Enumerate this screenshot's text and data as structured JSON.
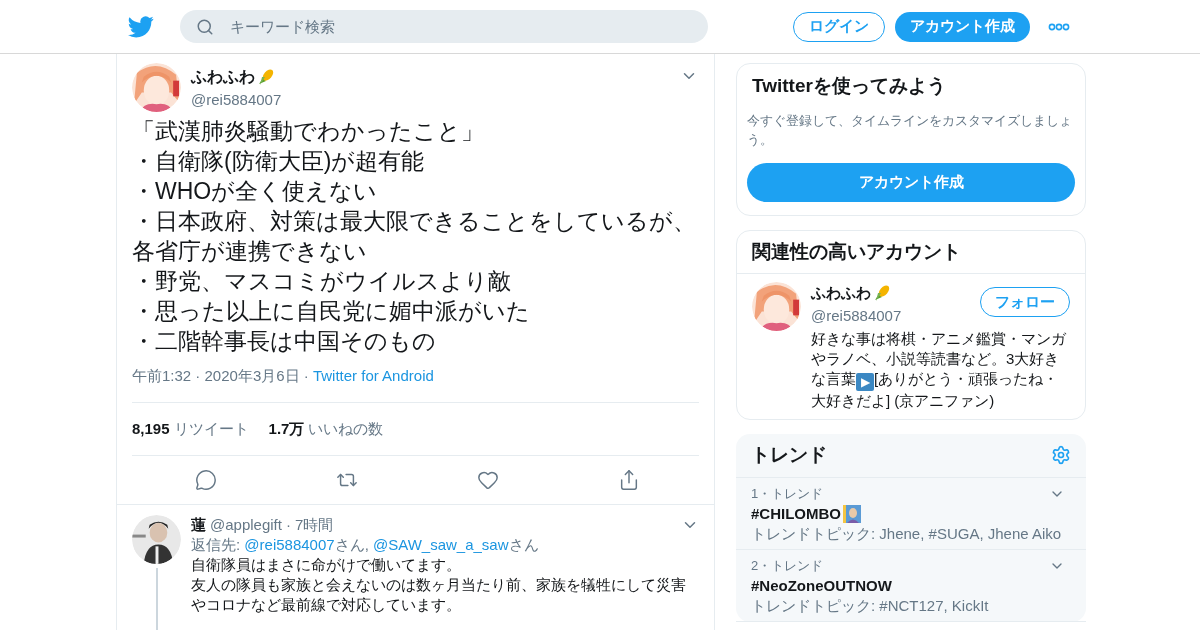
{
  "header": {
    "search_placeholder": "キーワード検索",
    "login": "ログイン",
    "signup": "アカウント作成"
  },
  "tweet": {
    "name": "ふわふわ",
    "handle": "@rei5884007",
    "lines": [
      "「武漢肺炎騒動でわかったこと」",
      "・自衛隊(防衛大臣)が超有能",
      "・WHOが全く使えない",
      "・日本政府、対策は最大限できることをしているが、各省庁が連携できない",
      "・野党、マスコミがウイルスより敵",
      "・思った以上に自民党に媚中派がいた",
      "・二階幹事長は中国そのもの"
    ],
    "timestamp": "午前1:32 · 2020年3月6日 ·",
    "source": "Twitter for Android",
    "stats": [
      {
        "count": "8,195",
        "label": "リツイート"
      },
      {
        "count": "1.7万",
        "label": "いいねの数"
      }
    ]
  },
  "reply": {
    "name": "蓮",
    "handle": "@applegift",
    "time": "· 7時間",
    "reply_to_label": "返信先:",
    "mentions": [
      {
        "handle": "@rei5884007",
        "suffix": "さん,"
      },
      {
        "handle": "@SAW_saw_a_saw",
        "suffix": "さん"
      }
    ],
    "text_lines": [
      "自衛隊員はまさに命がけで働いてます。",
      "友人の隊員も家族と会えないのは数ヶ月当たり前、家族を犠牲にして災害やコロナなど最前線で対応しています。"
    ]
  },
  "signup_card": {
    "title": "Twitterを使ってみよう",
    "description": "今すぐ登録して、タイムラインをカスタマイズしましょう。",
    "button": "アカウント作成"
  },
  "related": {
    "title": "関連性の高いアカウント",
    "accounts": [
      {
        "name": "ふわふわ",
        "handle": "@rei5884007",
        "follow": "フォロー",
        "bio_before": "好きな事は将棋・アニメ鑑賞・マンガやラノベ、小説等読書など。3大好きな言葉",
        "bio_icon": "▶",
        "bio_after": "[ありがとう・頑張ったね・大好きだよ] (京アニファン)"
      }
    ]
  },
  "trends": {
    "title": "トレンド",
    "items": [
      {
        "meta": "1・トレンド",
        "name": "#CHILOMBO",
        "emoji": true,
        "topics": "トレンドトピック: Jhene, #SUGA, Jhene Aiko"
      },
      {
        "meta": "2・トレンド",
        "name": "#NeoZoneOUTNOW",
        "emoji": false,
        "topics": "トレンドトピック: #NCT127, KickIt"
      }
    ]
  }
}
